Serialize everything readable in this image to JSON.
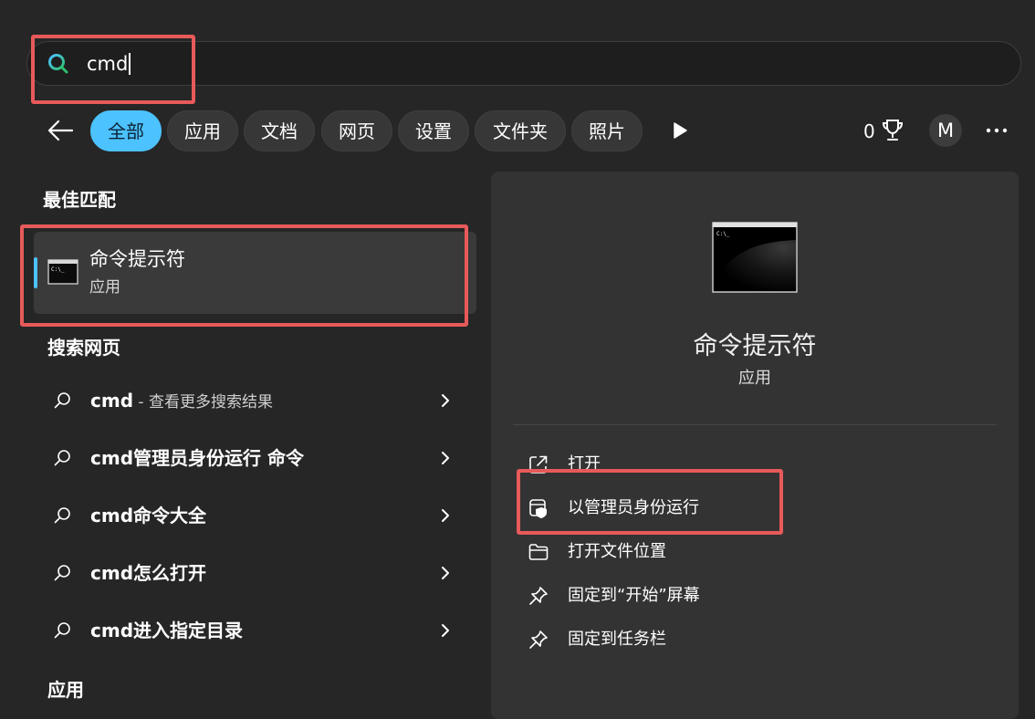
{
  "search": {
    "query": "cmd"
  },
  "filters": {
    "tabs": [
      "全部",
      "应用",
      "文档",
      "网页",
      "设置",
      "文件夹",
      "照片"
    ],
    "points": "0",
    "avatar_initial": "M"
  },
  "best_match": {
    "section_title": "最佳匹配",
    "name": "命令提示符",
    "type": "应用"
  },
  "web_search": {
    "section_title": "搜索网页",
    "items": [
      {
        "text": "cmd",
        "suffix": " - 查看更多搜索结果"
      },
      {
        "text": "cmd管理员身份运行 命令",
        "suffix": ""
      },
      {
        "text": "cmd命令大全",
        "suffix": ""
      },
      {
        "text": "cmd怎么打开",
        "suffix": ""
      },
      {
        "text": "cmd进入指定目录",
        "suffix": ""
      }
    ]
  },
  "apps_section": {
    "section_title": "应用"
  },
  "details": {
    "name": "命令提示符",
    "type": "应用",
    "actions": [
      {
        "label": "打开",
        "icon": "open-external-icon"
      },
      {
        "label": "以管理员身份运行",
        "icon": "shield-app-icon"
      },
      {
        "label": "打开文件位置",
        "icon": "folder-icon"
      },
      {
        "label": "固定到“开始”屏幕",
        "icon": "pin-icon"
      },
      {
        "label": "固定到任务栏",
        "icon": "pin-icon"
      }
    ]
  },
  "colors": {
    "background": "#262626",
    "panel": "#333333",
    "accent": "#4cc2ff",
    "highlight_box": "#e85a5a"
  }
}
